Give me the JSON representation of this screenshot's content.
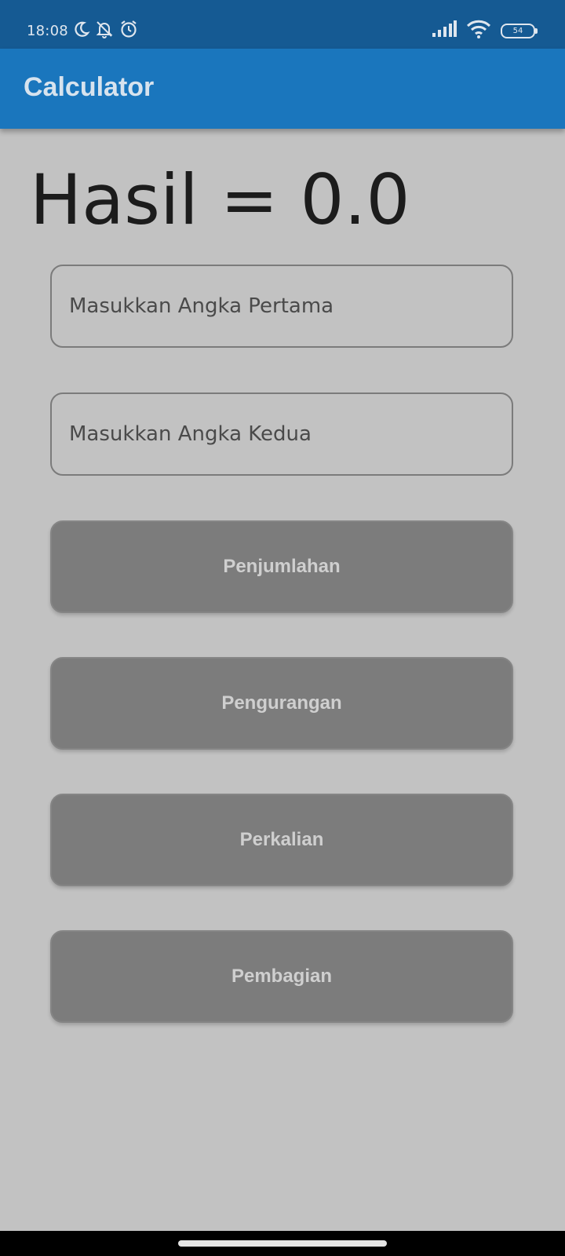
{
  "status_bar": {
    "time": "18:08",
    "battery_level": "54",
    "icons": [
      "moon-icon",
      "notifications-off-icon",
      "alarm-icon",
      "signal-icon",
      "wifi-icon",
      "battery-icon"
    ]
  },
  "app_bar": {
    "title": "Calculator",
    "color": "#1a76bd"
  },
  "result": {
    "text": "Hasil = 0.0"
  },
  "inputs": {
    "first_number": {
      "value": "",
      "placeholder": "Masukkan Angka Pertama"
    },
    "second_number": {
      "value": "",
      "placeholder": "Masukkan Angka Kedua"
    }
  },
  "buttons": {
    "addition": "Penjumlahan",
    "subtraction": "Pengurangan",
    "multiplication": "Perkalian",
    "division": "Pembagian"
  },
  "colors": {
    "status_bar": "#155a93",
    "background": "#c2c2c2",
    "button": "#7c7c7c",
    "button_text": "#cfcfcf"
  }
}
